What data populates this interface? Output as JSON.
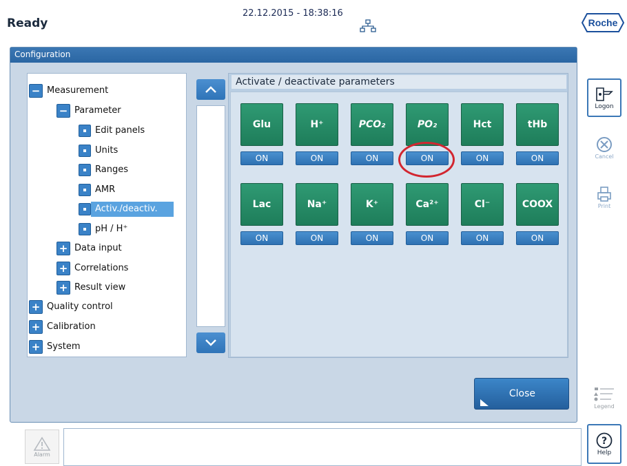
{
  "header": {
    "status": "Ready",
    "datetime": "22.12.2015 - 18:38:16",
    "brand": "Roche",
    "network_icon": "network-icon"
  },
  "window": {
    "title": "Configuration"
  },
  "tree": {
    "items": [
      {
        "label": "Measurement",
        "toggle": "−"
      },
      {
        "label": "Parameter",
        "toggle": "−"
      },
      {
        "label": "Edit panels"
      },
      {
        "label": "Units"
      },
      {
        "label": "Ranges"
      },
      {
        "label": "AMR"
      },
      {
        "label": "Activ./deactiv.",
        "selected": true
      },
      {
        "label": "pH / H⁺"
      },
      {
        "label": "Data input",
        "toggle": "+"
      },
      {
        "label": "Correlations",
        "toggle": "+"
      },
      {
        "label": "Result view",
        "toggle": "+"
      },
      {
        "label": "Quality control",
        "toggle": "+"
      },
      {
        "label": "Calibration",
        "toggle": "+"
      },
      {
        "label": "System",
        "toggle": "+"
      }
    ]
  },
  "params": {
    "header": "Activate / deactivate parameters",
    "row1": [
      {
        "name": "Glu",
        "state": "ON"
      },
      {
        "name": "H⁺",
        "state": "ON"
      },
      {
        "name": "PCO₂",
        "state": "ON"
      },
      {
        "name": "PO₂",
        "state": "ON"
      },
      {
        "name": "Hct",
        "state": "ON"
      },
      {
        "name": "tHb",
        "state": "ON"
      }
    ],
    "row2": [
      {
        "name": "Lac",
        "state": "ON"
      },
      {
        "name": "Na⁺",
        "state": "ON"
      },
      {
        "name": "K⁺",
        "state": "ON"
      },
      {
        "name": "Ca²⁺",
        "state": "ON"
      },
      {
        "name": "Cl⁻",
        "state": "ON"
      },
      {
        "name": "COOX",
        "state": "ON"
      }
    ]
  },
  "actions": {
    "close_label": "Close"
  },
  "sidebar": {
    "logon_label": "Logon",
    "cancel_label": "Cancel",
    "print_label": "Print",
    "legend_label": "Legend",
    "help_label": "Help"
  },
  "footer": {
    "alarm_label": "Alarm"
  },
  "colors": {
    "accent_blue": "#2f74b8",
    "tile_green": "#1e7d5a",
    "highlight_red": "#d22630"
  }
}
